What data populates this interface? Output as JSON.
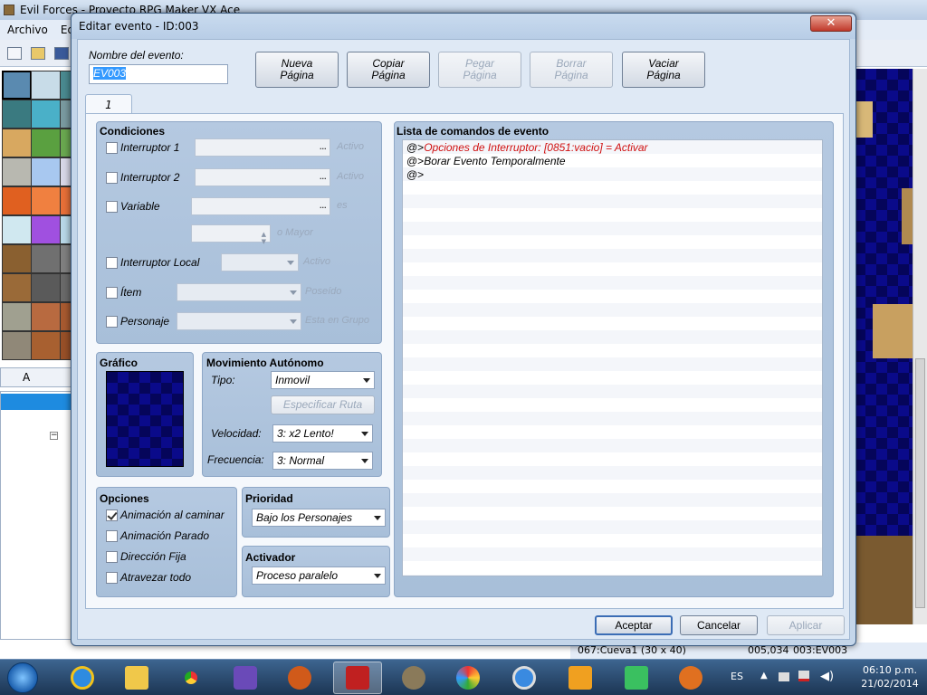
{
  "app": {
    "title": "Evil Forces - Proyecto RPG Maker VX Ace",
    "menu": [
      "Archivo",
      "Ed"
    ],
    "tile_tab": "A",
    "status_map": "067:Cueva1 (30 x 40)",
    "status_coord": "005,034",
    "status_event": "003:EV003"
  },
  "dialog": {
    "title": "Editar evento - ID:003",
    "close_label": "✕",
    "name_label": "Nombre del evento:",
    "name_value": "EV003",
    "buttons": {
      "new_page": [
        "Nueva",
        "Página"
      ],
      "copy_page": [
        "Copiar",
        "Página"
      ],
      "paste_page": [
        "Pegar",
        "Página"
      ],
      "delete_page": [
        "Borrar",
        "Página"
      ],
      "clear_page": [
        "Vaciar",
        "Página"
      ]
    },
    "page_tab": "1",
    "conditions": {
      "title": "Condiciones",
      "switch1": {
        "label": "Interruptor 1",
        "value": "",
        "suffix": "Activo"
      },
      "switch2": {
        "label": "Interruptor 2",
        "value": "",
        "suffix": "Activo"
      },
      "variable": {
        "label": "Variable",
        "value": "",
        "suffix": "es",
        "number_suffix": "o Mayor"
      },
      "local_switch": {
        "label": "Interruptor Local",
        "suffix": "Activo"
      },
      "item": {
        "label": "Ítem",
        "suffix": "Poseído"
      },
      "actor": {
        "label": "Personaje",
        "suffix": "Esta en Grupo"
      }
    },
    "graphic": {
      "title": "Gráfico"
    },
    "movement": {
      "title": "Movimiento Autónomo",
      "type_label": "Tipo:",
      "type_value": "Inmovil",
      "route_button": "Especificar Ruta",
      "speed_label": "Velocidad:",
      "speed_value": "3: x2 Lento!",
      "freq_label": "Frecuencia:",
      "freq_value": "3: Normal"
    },
    "options": {
      "title": "Opciones",
      "walk_anim": {
        "label": "Animación al caminar",
        "checked": true
      },
      "step_anim": {
        "label": "Animación Parado",
        "checked": false
      },
      "dir_fix": {
        "label": "Dirección Fija",
        "checked": false
      },
      "through": {
        "label": "Atravezar todo",
        "checked": false
      }
    },
    "priority": {
      "title": "Prioridad",
      "value": "Bajo los Personajes"
    },
    "trigger": {
      "title": "Activador",
      "value": "Proceso paralelo"
    },
    "command_list": {
      "title": "Lista de comandos de evento",
      "commands": [
        {
          "prefix": "@>",
          "text": "Opciones de Interruptor: [0851:vacio] = Activar",
          "color": "#d01010"
        },
        {
          "prefix": "@>",
          "text": "Borar Evento Temporalmente",
          "color": "#000000"
        },
        {
          "prefix": "@>",
          "text": "",
          "color": "#000000"
        }
      ]
    },
    "footer": {
      "ok": "Aceptar",
      "cancel": "Cancelar",
      "apply": "Aplicar"
    }
  },
  "taskbar": {
    "lang": "ES",
    "time": "06:10 p.m.",
    "date": "21/02/2014"
  }
}
